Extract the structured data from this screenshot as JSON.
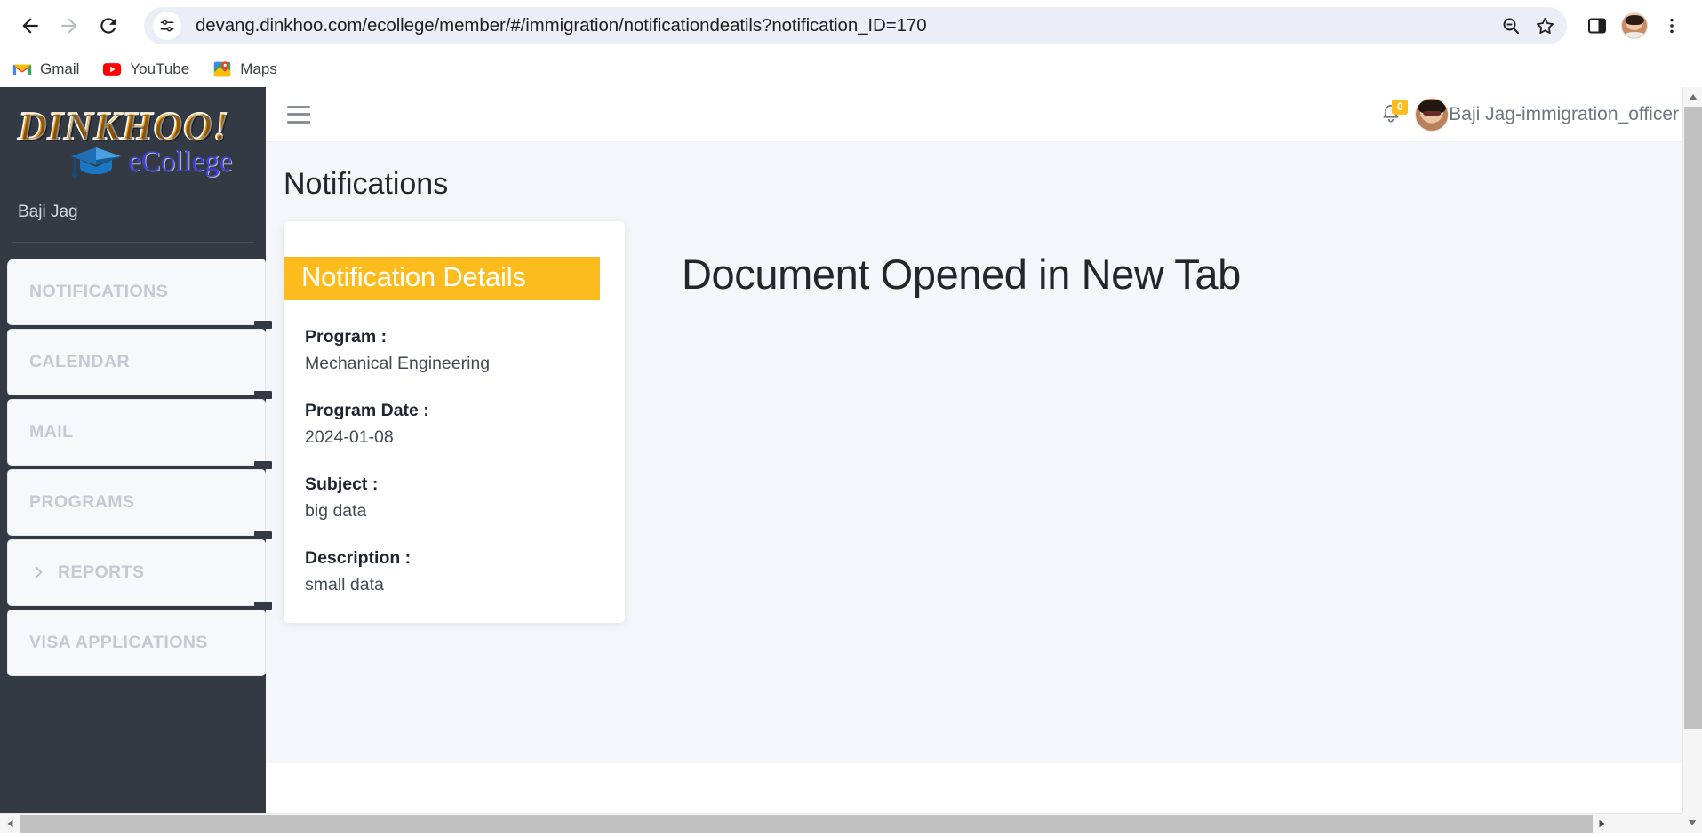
{
  "browser": {
    "back_label": "Back",
    "forward_label": "Forward",
    "reload_label": "Reload",
    "site_info_icon": "tune-icon",
    "url": "devang.dinkhoo.com/ecollege/member/#/immigration/notificationdeatils?notification_ID=170",
    "zoom_out_icon": "zoom-out-icon",
    "bookmark_icon": "star-icon",
    "side_panel_icon": "side-panel-icon",
    "profile_icon": "profile-avatar",
    "menu_icon": "three-dot-menu-icon",
    "bookmarks": [
      {
        "label": "Gmail",
        "icon": "gmail-icon"
      },
      {
        "label": "YouTube",
        "icon": "youtube-icon"
      },
      {
        "label": "Maps",
        "icon": "maps-icon"
      }
    ]
  },
  "sidebar": {
    "logo_main": "DINKHOO!",
    "logo_sub": "eCollege",
    "logo_cap_icon": "graduation-cap-icon",
    "user_name": "Baji Jag",
    "items": [
      {
        "label": "NOTIFICATIONS",
        "icon": ""
      },
      {
        "label": "CALENDAR",
        "icon": ""
      },
      {
        "label": "MAIL",
        "icon": ""
      },
      {
        "label": "PROGRAMS",
        "icon": ""
      },
      {
        "label": "REPORTS",
        "icon": "chevron-right-icon"
      },
      {
        "label": "VISA APPLICATIONS",
        "icon": ""
      }
    ]
  },
  "topbar": {
    "menu_toggle_icon": "hamburger-icon",
    "bell_icon": "bell-icon",
    "notification_count": "0",
    "avatar_icon": "user-avatar",
    "user_label": "Baji Jag-immigration_officer"
  },
  "page": {
    "title": "Notifications"
  },
  "detail_card": {
    "banner": "Notification Details",
    "fields": [
      {
        "label": "Program :",
        "value": "Mechanical Engineering"
      },
      {
        "label": "Program Date :",
        "value": "2024-01-08"
      },
      {
        "label": "Subject :",
        "value": "big data"
      },
      {
        "label": "Description :",
        "value": "small data"
      }
    ]
  },
  "document_pane": {
    "heading": "Document Opened in New Tab"
  },
  "colors": {
    "accent_yellow": "#fcbc1d",
    "sidebar_dark": "#343a44",
    "page_bg": "#f4f6f9",
    "menu_text": "#c4c9d2"
  }
}
